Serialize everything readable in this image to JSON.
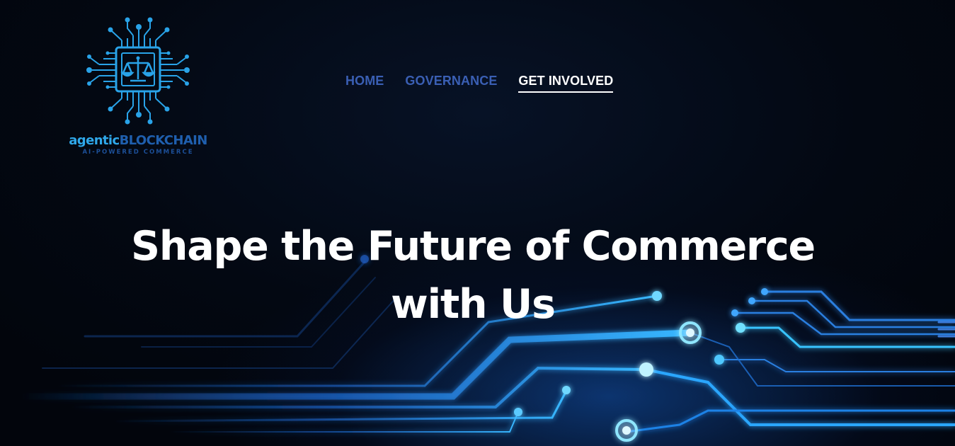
{
  "brand": {
    "name_part1": "agentic",
    "name_part2": "BLOCKCHAIN",
    "tagline": "AI-POWERED COMMERCE",
    "accent_color": "#2fa8ea"
  },
  "nav": {
    "items": [
      {
        "label": "HOME",
        "active": false
      },
      {
        "label": "GOVERNANCE",
        "active": false
      },
      {
        "label": "GET INVOLVED",
        "active": true
      }
    ]
  },
  "hero": {
    "heading": "Shape the Future of Commerce with Us"
  },
  "icons": {
    "logo": "scales-of-justice-chip-icon",
    "background": "circuit-traces-illustration"
  }
}
